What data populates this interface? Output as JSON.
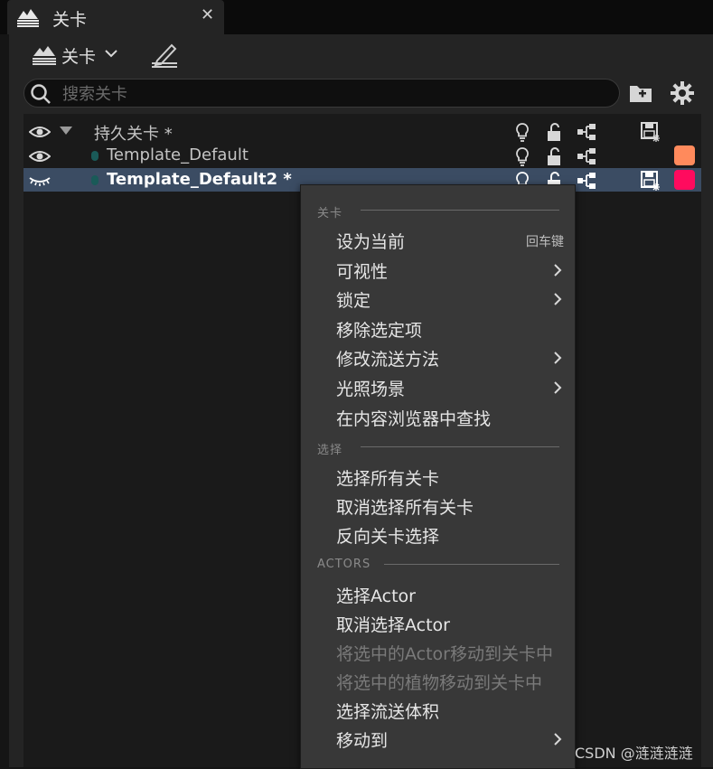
{
  "tab": {
    "title": "关卡",
    "close": "✕",
    "icon": "levels-icon"
  },
  "toolbar": {
    "levels_label": "关卡",
    "levels_icon": "levels-icon",
    "edit_icon": "edit-pencil-icon"
  },
  "search": {
    "placeholder": "搜索关卡",
    "value": ""
  },
  "levels": [
    {
      "name": "持久关卡 *",
      "visible": true,
      "expanded": true,
      "persistent": true
    },
    {
      "name": "Template_Default",
      "visible": true,
      "color": "#ff8a5c"
    },
    {
      "name": "Template_Default2 *",
      "visible": false,
      "selected": true,
      "color": "#ff0b5e"
    }
  ],
  "context_menu": {
    "sections": [
      {
        "title": "关卡",
        "items": [
          {
            "label": "设为当前",
            "shortcut": "回车键"
          },
          {
            "label": "可视性",
            "submenu": true
          },
          {
            "label": "锁定",
            "submenu": true
          },
          {
            "label": "移除选定项"
          },
          {
            "label": "修改流送方法",
            "submenu": true
          },
          {
            "label": "光照场景",
            "submenu": true
          },
          {
            "label": "在内容浏览器中查找"
          }
        ]
      },
      {
        "title": "选择",
        "items": [
          {
            "label": "选择所有关卡"
          },
          {
            "label": "取消选择所有关卡"
          },
          {
            "label": "反向关卡选择"
          }
        ]
      },
      {
        "title": "ACTORS",
        "items": [
          {
            "label": "选择Actor"
          },
          {
            "label": "取消选择Actor"
          },
          {
            "label": "将选中的Actor移动到关卡中",
            "disabled": true
          },
          {
            "label": "将选中的植物移动到关卡中",
            "disabled": true
          },
          {
            "label": "选择流送体积"
          },
          {
            "label": "移动到",
            "submenu": true
          }
        ]
      }
    ]
  },
  "watermark": "CSDN @涟涟涟涟",
  "colors": {
    "selected_row": "#3b4c63",
    "panel": "#242424",
    "menu": "#383838"
  }
}
